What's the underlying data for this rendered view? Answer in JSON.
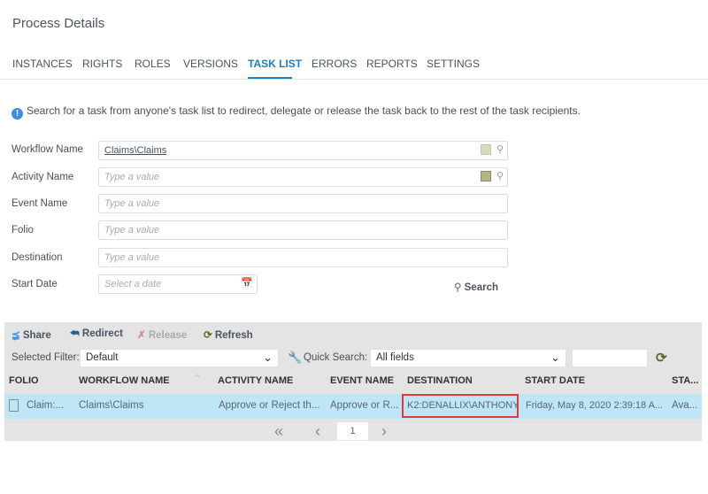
{
  "header": {
    "title": "Process Details"
  },
  "tabs": [
    "INSTANCES",
    "RIGHTS",
    "ROLES",
    "VERSIONS",
    "TASK LIST",
    "ERRORS",
    "REPORTS",
    "SETTINGS"
  ],
  "active_tab": "TASK LIST",
  "info": "Search for a task from anyone's task list to redirect, delegate or release the task back to the rest of the task recipients.",
  "form": {
    "workflow_name": {
      "label": "Workflow Name",
      "value": "Claims\\Claims"
    },
    "activity_name": {
      "label": "Activity Name",
      "placeholder": "Type a value"
    },
    "event_name": {
      "label": "Event Name",
      "placeholder": "Type a value"
    },
    "folio": {
      "label": "Folio",
      "placeholder": "Type a value"
    },
    "destination": {
      "label": "Destination",
      "placeholder": "Type a value"
    },
    "start_date": {
      "label": "Start Date",
      "placeholder": "Select a date"
    },
    "search_label": "Search"
  },
  "toolbar": {
    "share": "Share",
    "redirect": "Redirect",
    "release": "Release",
    "refresh": "Refresh"
  },
  "filter": {
    "label": "Selected Filter:",
    "value": "Default",
    "quick_label": "Quick Search:",
    "quick_value": "All fields",
    "quick_text": ""
  },
  "columns": [
    "FOLIO",
    "WORKFLOW NAME",
    "ACTIVITY NAME",
    "EVENT NAME",
    "DESTINATION",
    "START DATE",
    "STA..."
  ],
  "rows": [
    {
      "folio": "Claim:...",
      "workflow": "Claims\\Claims",
      "activity": "Approve or Reject th...",
      "event": "Approve or R...",
      "destination": "K2:DENALLIX\\ANTHONY",
      "start_date": "Friday, May 8, 2020 2:39:18 A...",
      "status": "Ava..."
    }
  ],
  "pager": {
    "page": "1"
  }
}
